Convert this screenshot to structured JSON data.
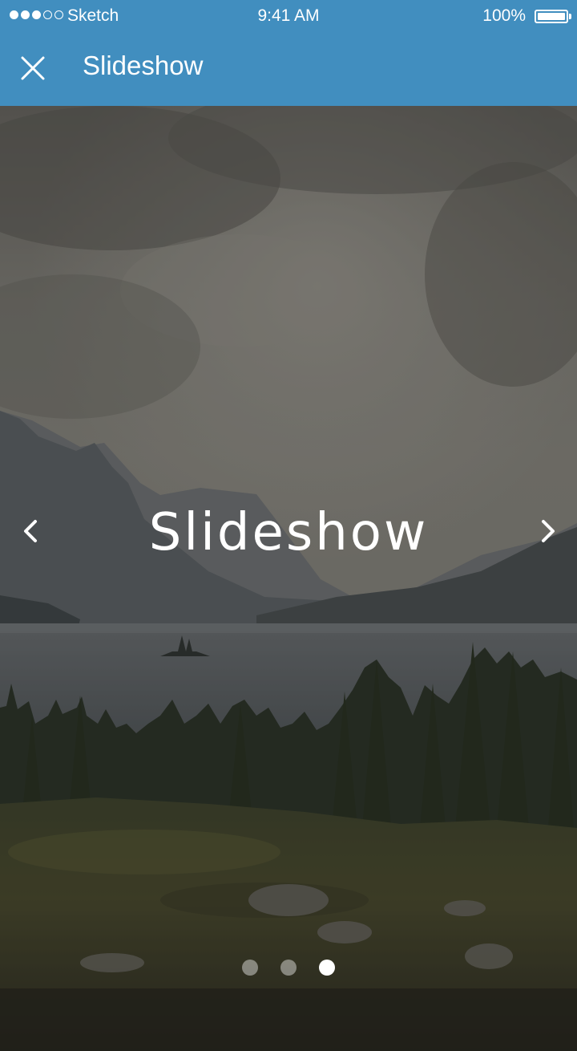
{
  "status_bar": {
    "carrier": "Sketch",
    "time": "9:41 AM",
    "battery_percent": "100%",
    "signal_bars_filled": 3,
    "signal_bars_total": 5,
    "battery_level": 1.0
  },
  "app_bar": {
    "title": "Slideshow",
    "close_icon": "close-icon",
    "background_color": "#418ebf"
  },
  "slide": {
    "title": "Slideshow",
    "prev_icon": "chevron-left-icon",
    "next_icon": "chevron-right-icon",
    "image_subject": "mountain lake landscape"
  },
  "pager": {
    "total": 3,
    "active_index": 2
  }
}
